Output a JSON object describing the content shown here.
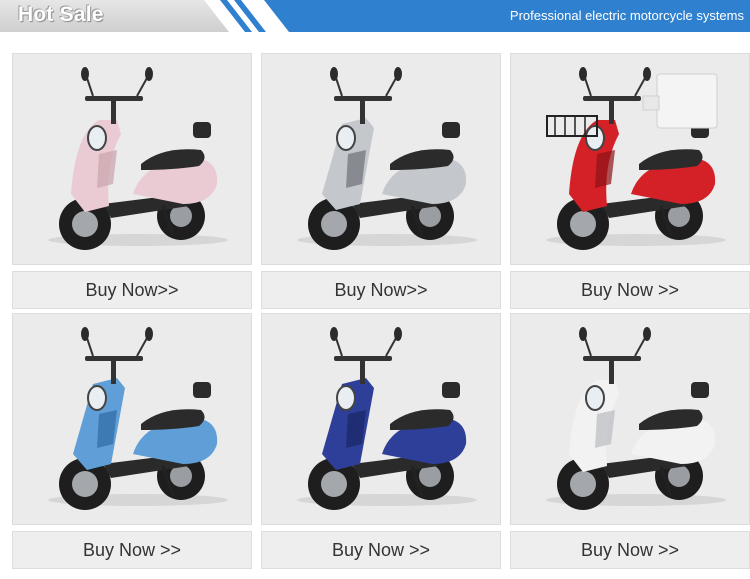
{
  "header": {
    "title": "Hot Sale",
    "tagline": "Professional electric motorcycle systems",
    "accent_color": "#2f80cf"
  },
  "products": [
    {
      "button_label": "Buy Now>>",
      "image": "pink-scooter",
      "body_color": "#eacbd3",
      "trim_color": "#c9a2ad"
    },
    {
      "button_label": "Buy Now>>",
      "image": "silver-scooter",
      "body_color": "#c4c7cc",
      "trim_color": "#6d7178"
    },
    {
      "button_label": "Buy Now >>",
      "image": "red-delivery-scooter",
      "body_color": "#d42027",
      "trim_color": "#8e1218"
    },
    {
      "button_label": "Buy Now >>",
      "image": "light-blue-scooter",
      "body_color": "#5f9ed6",
      "trim_color": "#2f6aa3"
    },
    {
      "button_label": "Buy Now >>",
      "image": "blue-scooter",
      "body_color": "#2d3f98",
      "trim_color": "#1a2666"
    },
    {
      "button_label": "Buy Now >>",
      "image": "white-scooter",
      "body_color": "#f2f2f2",
      "trim_color": "#b9bcc1"
    }
  ]
}
